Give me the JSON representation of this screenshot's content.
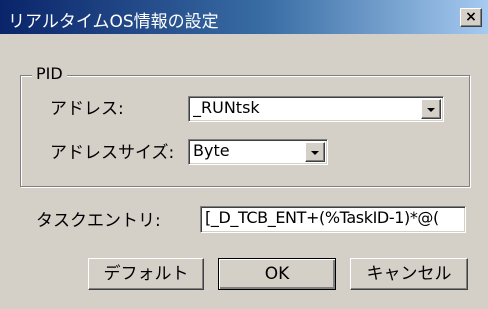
{
  "window": {
    "title": "リアルタイムOS情報の設定",
    "close_label": "×"
  },
  "pid_group": {
    "label": "PID",
    "address_label": "アドレス:",
    "address_value": "_RUNtsk",
    "address_size_label": "アドレスサイズ:",
    "address_size_value": "Byte"
  },
  "task_entry": {
    "label": "タスクエントリ:",
    "value": "[_D_TCB_ENT+(%TaskID-1)*@("
  },
  "buttons": {
    "default_label": "デフォルト",
    "ok_label": "OK",
    "cancel_label": "キャンセル"
  }
}
